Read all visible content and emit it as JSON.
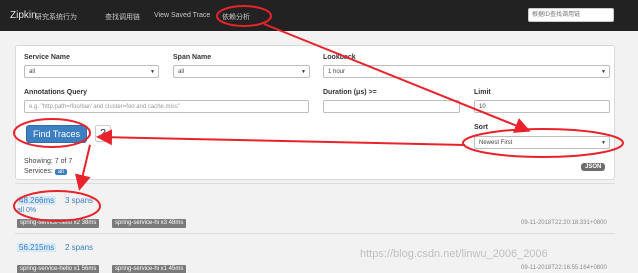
{
  "navbar": {
    "brand": "Zipkin",
    "links": [
      "研究系统行为",
      "查找调用链",
      "View Saved Trace",
      "依赖分析"
    ],
    "search_placeholder": "根据ID查找调用链"
  },
  "form": {
    "service_name": {
      "label": "Service Name",
      "value": "all"
    },
    "span_name": {
      "label": "Span Name",
      "value": "all"
    },
    "lookback": {
      "label": "Lookback",
      "value": "1 hour"
    },
    "annotations_query": {
      "label": "Annotations Query",
      "placeholder": "e.g. \"http.path=/foo/bar/ and cluster=foo and cache.miss\""
    },
    "duration": {
      "label": "Duration (μs) >=",
      "value": ""
    },
    "limit": {
      "label": "Limit",
      "value": "10"
    },
    "sort": {
      "label": "Sort",
      "value": "Newest First"
    },
    "find_button": "Find Traces",
    "help_icon": "?"
  },
  "results": {
    "showing": "Showing: 7 of 7",
    "services_label": "Services:",
    "services_badge": "all",
    "json_button": "JSON"
  },
  "traces": [
    {
      "duration": "48.266ms",
      "spans": "3 spans",
      "error": "all 0%",
      "services": [
        "spring-service-hello x2 38ms",
        "spring-service-hi x3 48ms"
      ],
      "timestamp": "09-11-2018T22:20:18.331+0800"
    },
    {
      "duration": "56.215ms",
      "spans": "2 spans",
      "error": "",
      "services": [
        "spring-service-hello x1 56ms",
        "spring-service-hi x1 45ms"
      ],
      "timestamp": "09-11-2018T22:16:55.164+0800"
    }
  ],
  "watermark": "https://blog.csdn.net/linwu_2006_2006",
  "colors": {
    "navbar": "#222222",
    "primary": "#3d7fc1",
    "annotation_red": "#e8232b",
    "badge_gray": "#7a7a7a"
  }
}
